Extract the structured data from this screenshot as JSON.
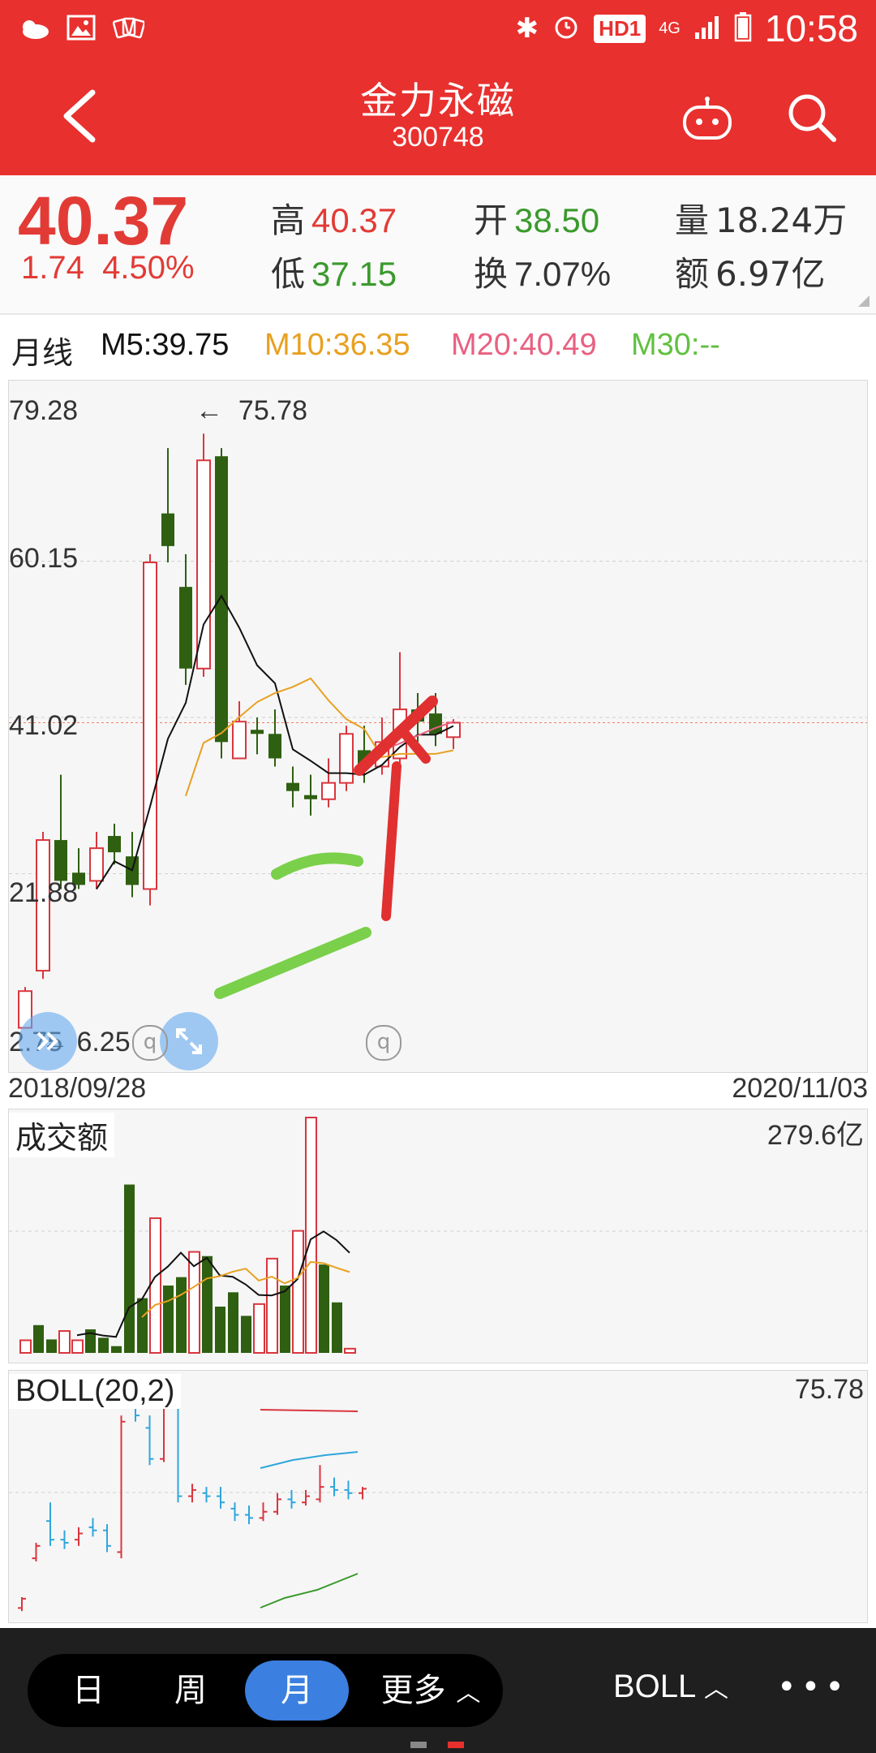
{
  "status_bar": {
    "time": "10:58",
    "hd_badge": "HD1",
    "network": "4G"
  },
  "header": {
    "title": "金力永磁",
    "code": "300748"
  },
  "quote": {
    "price": "40.37",
    "change": "1.74",
    "change_pct": "4.50%",
    "high_label": "高",
    "high": "40.37",
    "low_label": "低",
    "low": "37.15",
    "open_label": "开",
    "open": "38.50",
    "turnover_label": "换",
    "turnover": "7.07%",
    "volume_label": "量",
    "volume": "18.24万",
    "amount_label": "额",
    "amount": "6.97亿"
  },
  "ma": {
    "period": "月线",
    "m5": "M5:39.75",
    "m10": "M10:36.35",
    "m20": "M20:40.49",
    "m30": "M30:--",
    "colors": {
      "m5": "#111111",
      "m10": "#e8a020",
      "m20": "#e86080",
      "m30": "#60c040"
    }
  },
  "main_chart": {
    "y_labels": [
      "79.28",
      "60.15",
      "41.02",
      "21.88",
      "2.75"
    ],
    "high_marker": "75.78",
    "low_marker": "6.25",
    "start_date": "2018/09/28",
    "end_date": "2020/11/03"
  },
  "volume_panel": {
    "title": "成交额",
    "max_label": "279.6亿"
  },
  "boll_panel": {
    "title": "BOLL(20,2)",
    "max_label": "75.78"
  },
  "chart_data": {
    "type": "candlestick",
    "ylim": [
      2.75,
      79.28
    ],
    "candles": [
      {
        "o": 3.0,
        "c": 7.5,
        "h": 8.0,
        "l": 2.9,
        "up": true
      },
      {
        "o": 10.0,
        "c": 26.0,
        "h": 27.0,
        "l": 9.0,
        "up": true
      },
      {
        "o": 26.0,
        "c": 21.0,
        "h": 34.0,
        "l": 20.0,
        "up": false
      },
      {
        "o": 22.0,
        "c": 20.5,
        "h": 25.0,
        "l": 20.0,
        "up": false
      },
      {
        "o": 21.0,
        "c": 25.0,
        "h": 27.0,
        "l": 20.0,
        "up": true
      },
      {
        "o": 26.5,
        "c": 24.5,
        "h": 28.0,
        "l": 23.0,
        "up": false
      },
      {
        "o": 24.0,
        "c": 20.5,
        "h": 27.0,
        "l": 19.0,
        "up": false
      },
      {
        "o": 20.0,
        "c": 60.0,
        "h": 61.0,
        "l": 18.0,
        "up": true
      },
      {
        "o": 66.0,
        "c": 62.0,
        "h": 74.0,
        "l": 60.0,
        "up": false
      },
      {
        "o": 57.0,
        "c": 47.0,
        "h": 61.0,
        "l": 45.0,
        "up": false
      },
      {
        "o": 47.0,
        "c": 72.5,
        "h": 75.78,
        "l": 46.0,
        "up": true
      },
      {
        "o": 73.0,
        "c": 38.0,
        "h": 74.0,
        "l": 36.0,
        "up": false
      },
      {
        "o": 36.0,
        "c": 40.5,
        "h": 43.0,
        "l": 36.0,
        "up": true
      },
      {
        "o": 39.5,
        "c": 39.0,
        "h": 41.0,
        "l": 36.5,
        "up": false
      },
      {
        "o": 39.0,
        "c": 36.0,
        "h": 42.0,
        "l": 35.0,
        "up": false
      },
      {
        "o": 33.0,
        "c": 32.0,
        "h": 35.0,
        "l": 30.0,
        "up": false
      },
      {
        "o": 31.5,
        "c": 31.0,
        "h": 34.0,
        "l": 29.0,
        "up": false
      },
      {
        "o": 31.0,
        "c": 33.0,
        "h": 36.0,
        "l": 30.0,
        "up": true
      },
      {
        "o": 33.0,
        "c": 39.0,
        "h": 40.0,
        "l": 32.0,
        "up": true
      },
      {
        "o": 37.0,
        "c": 35.0,
        "h": 40.0,
        "l": 33.0,
        "up": false
      },
      {
        "o": 35.0,
        "c": 38.0,
        "h": 41.0,
        "l": 34.0,
        "up": true
      },
      {
        "o": 36.0,
        "c": 42.0,
        "h": 49.0,
        "l": 35.0,
        "up": true
      },
      {
        "o": 42.0,
        "c": 40.5,
        "h": 44.0,
        "l": 38.0,
        "up": false
      },
      {
        "o": 41.5,
        "c": 39.0,
        "h": 44.0,
        "l": 37.5,
        "up": false
      },
      {
        "o": 38.6,
        "c": 40.37,
        "h": 40.8,
        "l": 37.15,
        "up": true
      }
    ],
    "volume": [
      {
        "v": 15,
        "up": true
      },
      {
        "v": 33,
        "up": false
      },
      {
        "v": 16,
        "up": false
      },
      {
        "v": 26,
        "up": true
      },
      {
        "v": 15,
        "up": true
      },
      {
        "v": 28,
        "up": false
      },
      {
        "v": 18,
        "up": false
      },
      {
        "v": 8,
        "up": false
      },
      {
        "v": 200,
        "up": false
      },
      {
        "v": 65,
        "up": false
      },
      {
        "v": 160,
        "up": true
      },
      {
        "v": 80,
        "up": false
      },
      {
        "v": 90,
        "up": false
      },
      {
        "v": 120,
        "up": true
      },
      {
        "v": 115,
        "up": false
      },
      {
        "v": 55,
        "up": false
      },
      {
        "v": 72,
        "up": false
      },
      {
        "v": 44,
        "up": false
      },
      {
        "v": 58,
        "up": true
      },
      {
        "v": 112,
        "up": true
      },
      {
        "v": 80,
        "up": false
      },
      {
        "v": 145,
        "up": true
      },
      {
        "v": 279.6,
        "up": true
      },
      {
        "v": 105,
        "up": false
      },
      {
        "v": 60,
        "up": false
      },
      {
        "v": 5,
        "up": true
      }
    ],
    "boll_bars": [
      {
        "o": 2.0,
        "c": 5.0,
        "h": 5.5,
        "l": 1.0,
        "color": "red"
      },
      {
        "o": 18.0,
        "c": 22.0,
        "h": 23.0,
        "l": 17.0,
        "color": "red"
      },
      {
        "o": 30.0,
        "c": 24.0,
        "h": 36.0,
        "l": 22.0,
        "color": "blue"
      },
      {
        "o": 24.0,
        "c": 23.0,
        "h": 27.0,
        "l": 21.0,
        "color": "blue"
      },
      {
        "o": 24.0,
        "c": 26.0,
        "h": 28.0,
        "l": 22.0,
        "color": "red"
      },
      {
        "o": 28.0,
        "c": 27.0,
        "h": 31.0,
        "l": 25.0,
        "color": "blue"
      },
      {
        "o": 27.0,
        "c": 22.0,
        "h": 29.0,
        "l": 20.0,
        "color": "blue"
      },
      {
        "o": 20.0,
        "c": 62.0,
        "h": 64.0,
        "l": 18.0,
        "color": "red"
      },
      {
        "o": 68.0,
        "c": 64.0,
        "h": 76.0,
        "l": 62.0,
        "color": "blue"
      },
      {
        "o": 60.0,
        "c": 50.0,
        "h": 64.0,
        "l": 48.0,
        "color": "blue"
      },
      {
        "o": 50.0,
        "c": 75.0,
        "h": 76.0,
        "l": 49.0,
        "color": "red"
      },
      {
        "o": 76.0,
        "c": 38.0,
        "h": 77.0,
        "l": 36.0,
        "color": "blue"
      },
      {
        "o": 38.0,
        "c": 40.0,
        "h": 42.0,
        "l": 36.0,
        "color": "red"
      },
      {
        "o": 39.0,
        "c": 38.0,
        "h": 41.0,
        "l": 36.0,
        "color": "blue"
      },
      {
        "o": 38.0,
        "c": 36.0,
        "h": 41.0,
        "l": 34.0,
        "color": "blue"
      },
      {
        "o": 34.0,
        "c": 32.0,
        "h": 36.0,
        "l": 30.0,
        "color": "blue"
      },
      {
        "o": 32.0,
        "c": 31.0,
        "h": 35.0,
        "l": 29.0,
        "color": "blue"
      },
      {
        "o": 31.0,
        "c": 33.0,
        "h": 36.0,
        "l": 30.0,
        "color": "red"
      },
      {
        "o": 33.0,
        "c": 37.0,
        "h": 39.0,
        "l": 32.0,
        "color": "red"
      },
      {
        "o": 37.0,
        "c": 36.0,
        "h": 40.0,
        "l": 34.0,
        "color": "blue"
      },
      {
        "o": 36.0,
        "c": 38.0,
        "h": 40.0,
        "l": 35.0,
        "color": "red"
      },
      {
        "o": 37.0,
        "c": 41.0,
        "h": 48.0,
        "l": 36.0,
        "color": "red"
      },
      {
        "o": 41.0,
        "c": 40.0,
        "h": 44.0,
        "l": 38.0,
        "color": "blue"
      },
      {
        "o": 40.0,
        "c": 39.0,
        "h": 43.0,
        "l": 37.0,
        "color": "blue"
      },
      {
        "o": 39.0,
        "c": 40.4,
        "h": 41.0,
        "l": 37.0,
        "color": "red"
      }
    ]
  },
  "bottom_bar": {
    "tabs": [
      "日",
      "周",
      "月",
      "更多"
    ],
    "active_tab": "月",
    "indicator_button": "BOLL",
    "more_button": "•••"
  }
}
